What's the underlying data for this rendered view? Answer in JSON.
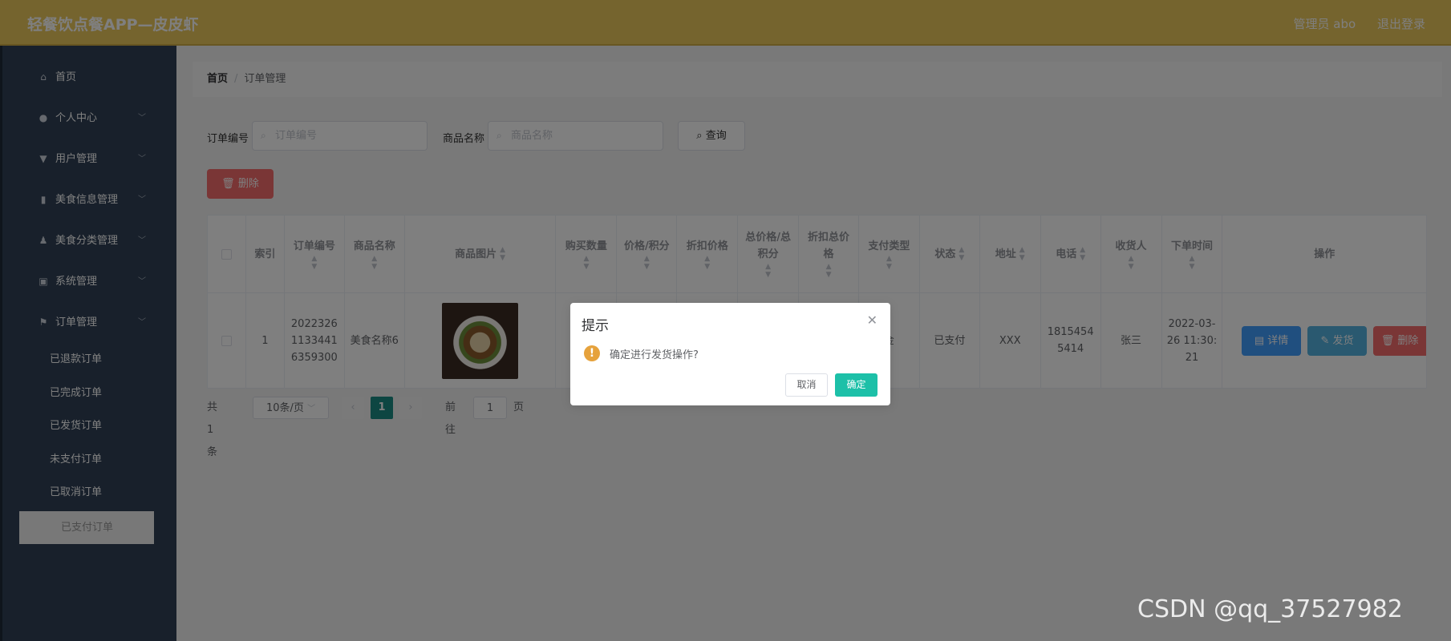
{
  "header": {
    "title": "轻餐饮点餐APP—皮皮虾",
    "admin": "管理员 abo",
    "logout": "退出登录"
  },
  "sidebar": {
    "items": [
      {
        "label": "首页",
        "icon": "home-icon",
        "has_children": false
      },
      {
        "label": "个人中心",
        "icon": "user-icon",
        "has_children": true
      },
      {
        "label": "用户管理",
        "icon": "trophy-icon",
        "has_children": true
      },
      {
        "label": "美食信息管理",
        "icon": "book-icon",
        "has_children": true
      },
      {
        "label": "美食分类管理",
        "icon": "person-icon",
        "has_children": true
      },
      {
        "label": "系统管理",
        "icon": "clipboard-icon",
        "has_children": true
      },
      {
        "label": "订单管理",
        "icon": "flag-icon",
        "has_children": true
      }
    ],
    "sub_items": [
      {
        "label": "已退款订单",
        "active": false
      },
      {
        "label": "已完成订单",
        "active": false
      },
      {
        "label": "已发货订单",
        "active": false
      },
      {
        "label": "未支付订单",
        "active": false
      },
      {
        "label": "已取消订单",
        "active": false
      },
      {
        "label": "已支付订单",
        "active": true
      }
    ]
  },
  "breadcrumb": {
    "home": "首页",
    "separator": "/",
    "current": "订单管理"
  },
  "search": {
    "order_no_label": "订单编号",
    "order_no_placeholder": "订单编号",
    "product_label": "商品名称",
    "product_placeholder": "商品名称",
    "query_button": "查询"
  },
  "toolbar": {
    "delete_button": "删除"
  },
  "table": {
    "columns": [
      "",
      "索引",
      "订单编号",
      "商品名称",
      "商品图片",
      "购买数量",
      "价格/积分",
      "折扣价格",
      "总价格/总积分",
      "折扣总价格",
      "支付类型",
      "状态",
      "地址",
      "电话",
      "收货人",
      "下单时间",
      "操作"
    ],
    "rows": [
      {
        "index": "1",
        "order_no": "20223261133441 6359300",
        "product_name": "美食名称6",
        "quantity": "",
        "price": "",
        "discount_price": "",
        "total": "",
        "discount_total": "",
        "pay_type": "金",
        "status": "已支付",
        "address": "XXX",
        "phone": "18154545414",
        "receiver": "张三",
        "order_time": "2022-03-26 11:30:21"
      }
    ],
    "actions": {
      "detail": "详情",
      "ship": "发货",
      "delete": "删除"
    }
  },
  "pagination": {
    "total": "共 1 条",
    "page_size": "10条/页",
    "current_page": "1",
    "goto_label": "前往",
    "goto_value": "1",
    "page_suffix": "页"
  },
  "dialog": {
    "title": "提示",
    "message": "确定进行发货操作?",
    "cancel": "取消",
    "confirm": "确定"
  },
  "watermark": "CSDN @qq_37527982"
}
